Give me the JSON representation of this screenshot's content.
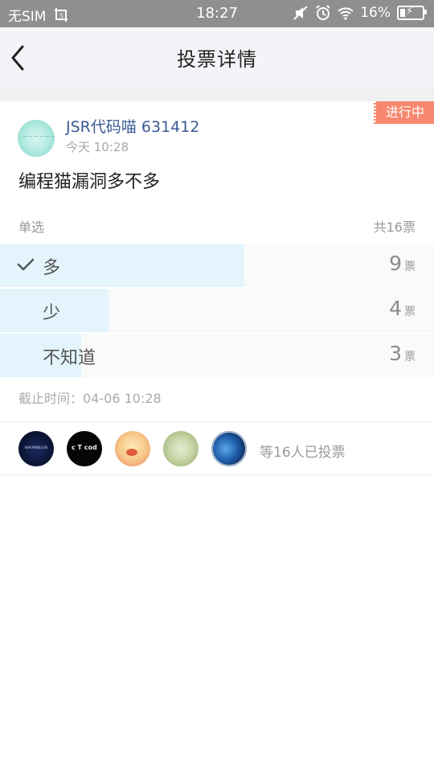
{
  "status_bar": {
    "carrier": "无SIM",
    "time": "18:27",
    "battery": "16%",
    "icons": [
      "screenshot-icon",
      "mute-icon",
      "alarm-icon",
      "wifi-icon",
      "battery-charging-icon"
    ]
  },
  "nav": {
    "title": "投票详情",
    "back_icon": "chevron-left-icon"
  },
  "post": {
    "status_tag": "进行中",
    "author": "JSR代码喵 631412",
    "time": "今天 10:28",
    "question": "编程猫漏洞多不多",
    "vote_type": "单选",
    "total": "共16票",
    "options": [
      {
        "label": "多",
        "count": "9",
        "unit": "票",
        "fraction": 0.5625,
        "selected": true
      },
      {
        "label": "少",
        "count": "4",
        "unit": "票",
        "fraction": 0.25,
        "selected": false
      },
      {
        "label": "不知道",
        "count": "3",
        "unit": "票",
        "fraction": 0.1875,
        "selected": false
      }
    ],
    "deadline": "截止时间：04-06 10:28"
  },
  "voters": {
    "summary": "等16人已投票",
    "count_shown": 5
  },
  "colors": {
    "status_tag": "#f7876f",
    "author_name": "#3a5a93",
    "option_fill": "#e3f4fd",
    "nav_bg": "#f3f4f7"
  }
}
